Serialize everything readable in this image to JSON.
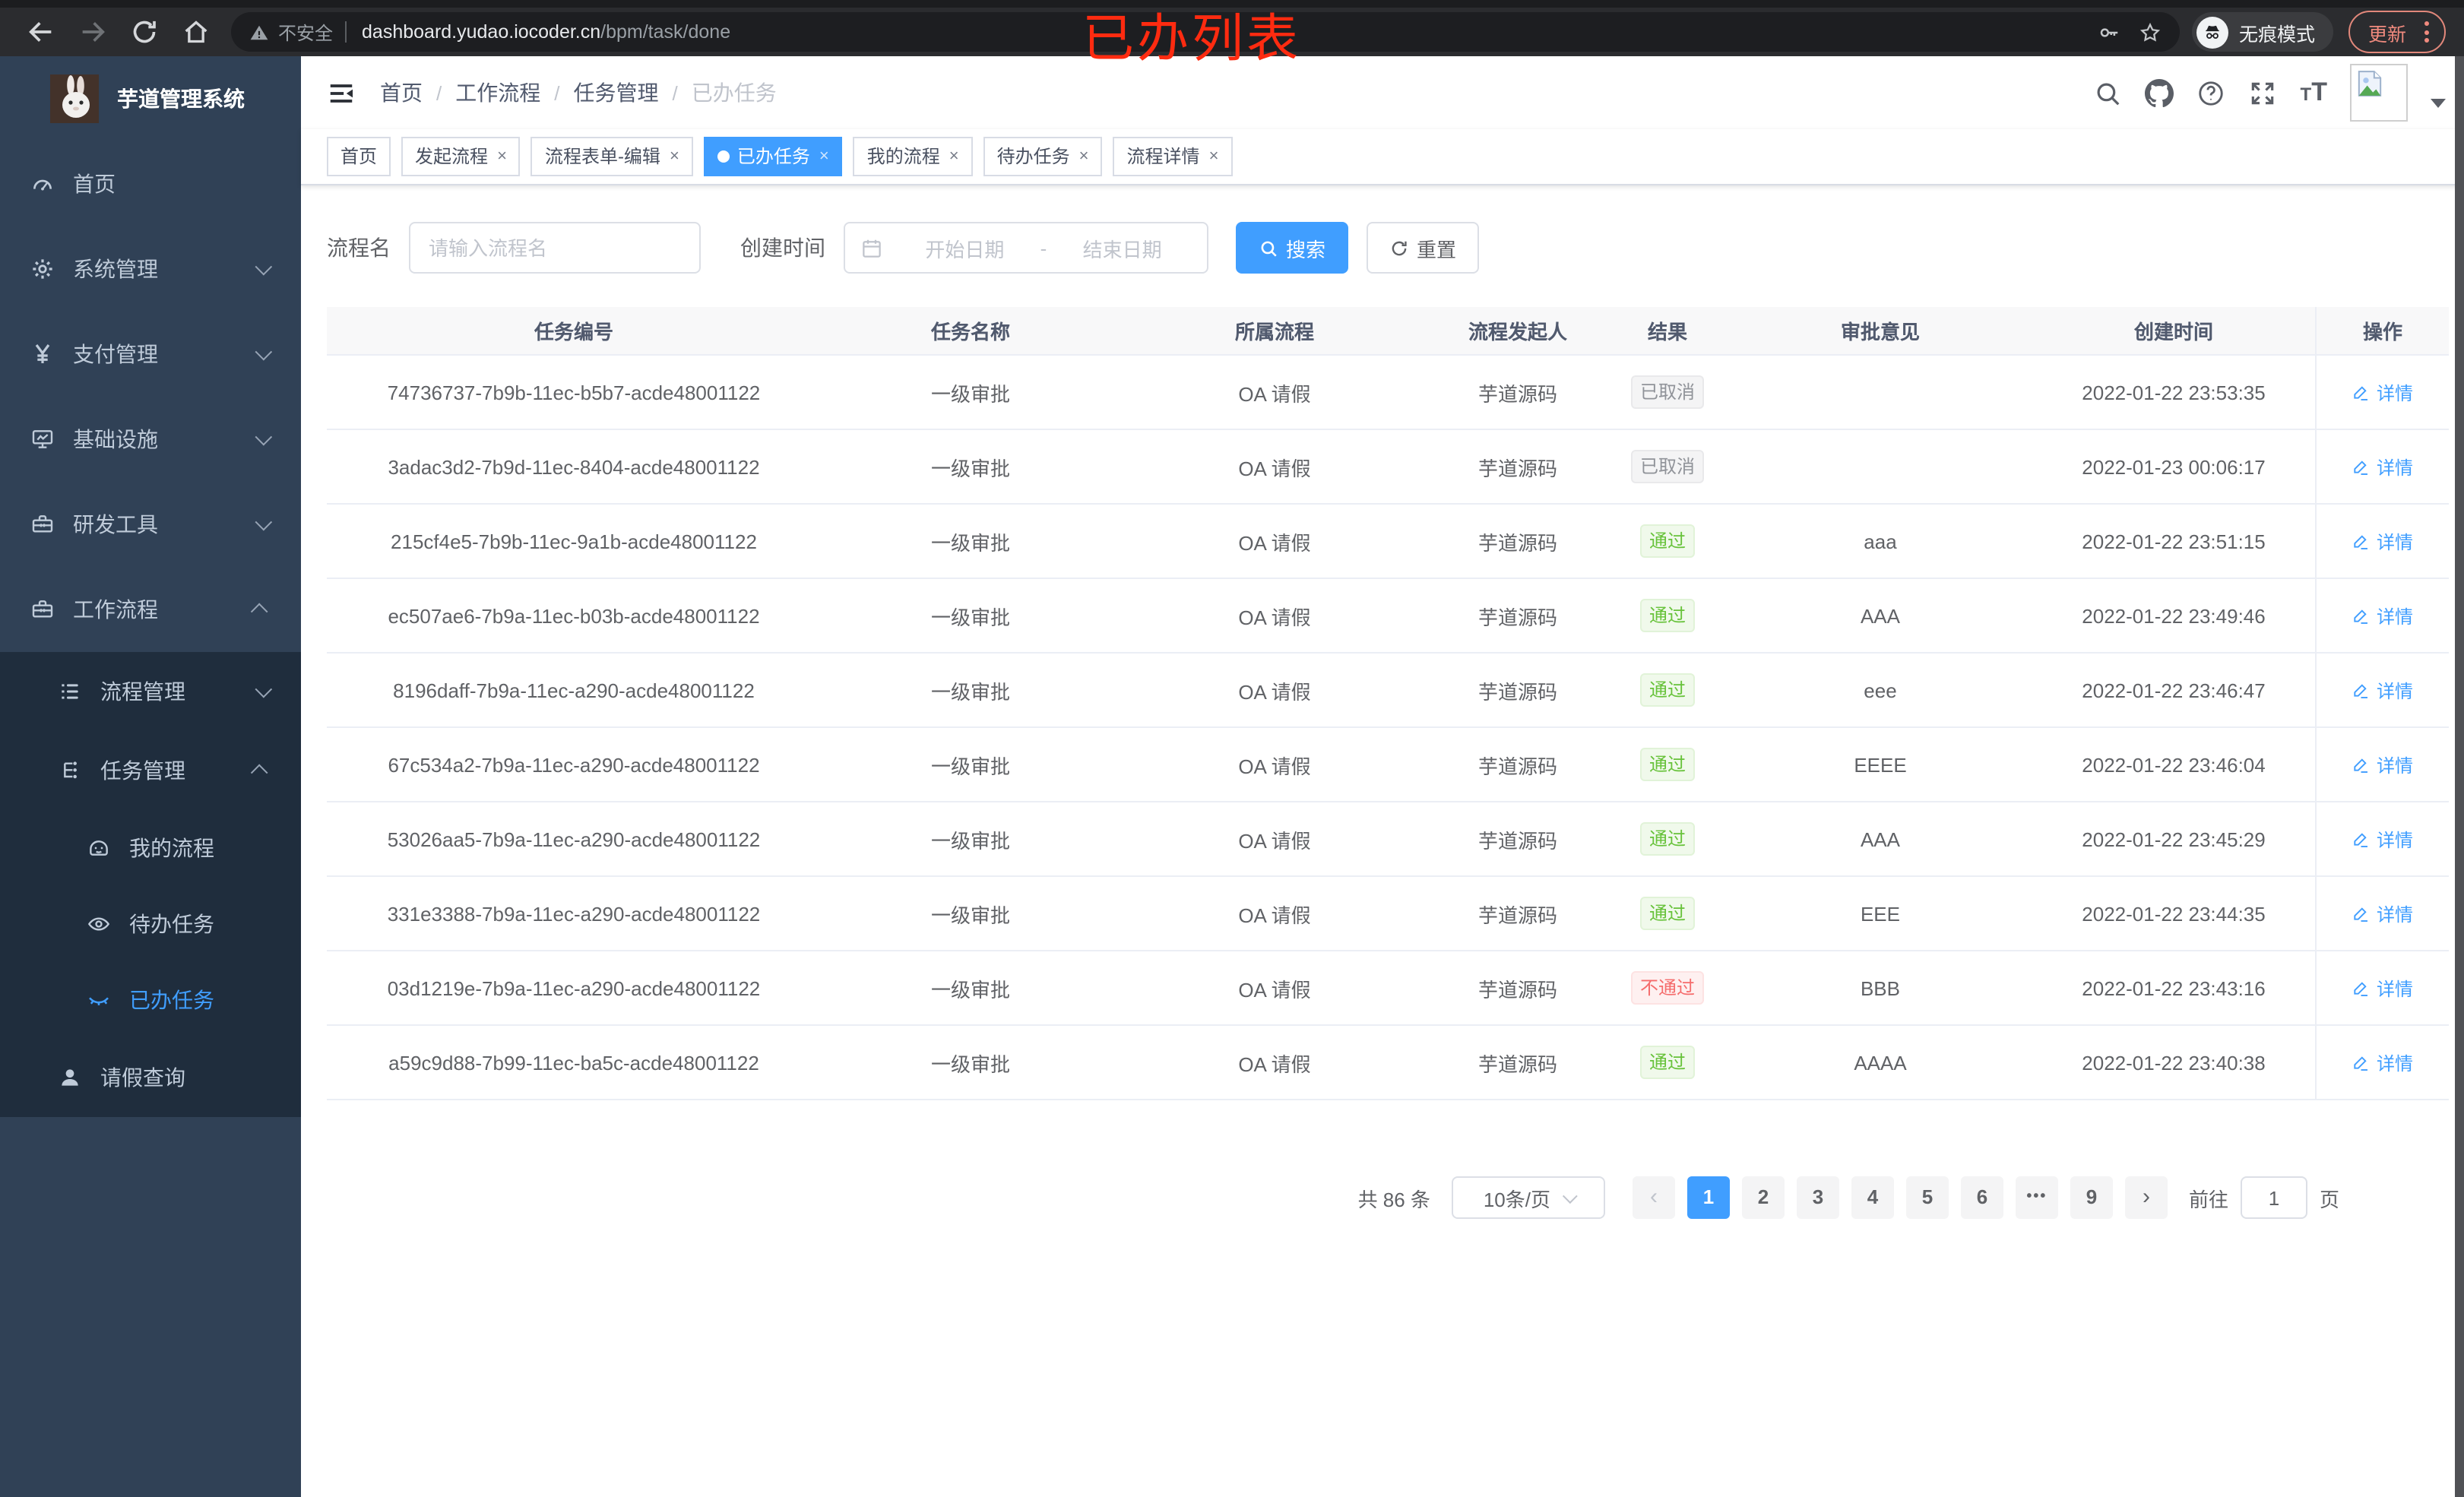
{
  "browser": {
    "security_label": "不安全",
    "url_host": "dashboard.yudao.iocoder.cn",
    "url_path": "/bpm/task/done",
    "incognito_label": "无痕模式",
    "update_label": "更新",
    "annotation": "已办列表"
  },
  "sidebar": {
    "title": "芋道管理系统",
    "items": [
      {
        "key": "home",
        "label": "首页",
        "icon": "gauge",
        "level": 1
      },
      {
        "key": "system-management",
        "label": "系统管理",
        "icon": "gear",
        "level": 1,
        "chevron": "down"
      },
      {
        "key": "payment-management",
        "label": "支付管理",
        "icon": "yen",
        "level": 1,
        "chevron": "down"
      },
      {
        "key": "infrastructure",
        "label": "基础设施",
        "icon": "monitor",
        "level": 1,
        "chevron": "down"
      },
      {
        "key": "dev-tools",
        "label": "研发工具",
        "icon": "toolbox",
        "level": 1,
        "chevron": "down"
      },
      {
        "key": "workflow",
        "label": "工作流程",
        "icon": "briefcase",
        "level": 1,
        "chevron": "up"
      },
      {
        "key": "process-management",
        "label": "流程管理",
        "icon": "list",
        "level": 2,
        "chevron": "down",
        "dark": true
      },
      {
        "key": "task-management",
        "label": "任务管理",
        "icon": "flow",
        "level": 2,
        "chevron": "up",
        "dark": true
      },
      {
        "key": "my-process",
        "label": "我的流程",
        "icon": "face",
        "level": 3,
        "dark": true
      },
      {
        "key": "todo-tasks",
        "label": "待办任务",
        "icon": "eye",
        "level": 3,
        "dark": true
      },
      {
        "key": "done-tasks",
        "label": "已办任务",
        "icon": "eye-closed",
        "level": 3,
        "dark": true,
        "active": true
      },
      {
        "key": "leave-query",
        "label": "请假查询",
        "icon": "user",
        "level": 2,
        "dark": true
      }
    ]
  },
  "breadcrumb": {
    "items": [
      "首页",
      "工作流程",
      "任务管理",
      "已办任务"
    ],
    "separator": "/"
  },
  "tags_view": {
    "items": [
      {
        "key": "home",
        "label": "首页",
        "closable": false,
        "active": false
      },
      {
        "key": "start-process",
        "label": "发起流程",
        "closable": true,
        "active": false
      },
      {
        "key": "process-form-edit",
        "label": "流程表单-编辑",
        "closable": true,
        "active": false
      },
      {
        "key": "done-tasks",
        "label": "已办任务",
        "closable": true,
        "active": true
      },
      {
        "key": "my-process",
        "label": "我的流程",
        "closable": true,
        "active": false
      },
      {
        "key": "todo-tasks",
        "label": "待办任务",
        "closable": true,
        "active": false
      },
      {
        "key": "process-detail",
        "label": "流程详情",
        "closable": true,
        "active": false
      }
    ],
    "close_glyph": "×"
  },
  "filters": {
    "name_label": "流程名",
    "name_placeholder": "请输入流程名",
    "time_label": "创建时间",
    "start_placeholder": "开始日期",
    "range_separator": "-",
    "end_placeholder": "结束日期",
    "search_label": "搜索",
    "reset_label": "重置"
  },
  "table": {
    "columns": [
      "任务编号",
      "任务名称",
      "所属流程",
      "流程发起人",
      "结果",
      "审批意见",
      "创建时间",
      "操作"
    ],
    "action_label": "详情",
    "rows": [
      {
        "id": "74736737-7b9b-11ec-b5b7-acde48001122",
        "name": "一级审批",
        "process": "OA 请假",
        "starter": "芋道源码",
        "result": "已取消",
        "result_type": "info",
        "comment": "",
        "time": "2022-01-22 23:53:35"
      },
      {
        "id": "3adac3d2-7b9d-11ec-8404-acde48001122",
        "name": "一级审批",
        "process": "OA 请假",
        "starter": "芋道源码",
        "result": "已取消",
        "result_type": "info",
        "comment": "",
        "time": "2022-01-23 00:06:17"
      },
      {
        "id": "215cf4e5-7b9b-11ec-9a1b-acde48001122",
        "name": "一级审批",
        "process": "OA 请假",
        "starter": "芋道源码",
        "result": "通过",
        "result_type": "success",
        "comment": "aaa",
        "time": "2022-01-22 23:51:15"
      },
      {
        "id": "ec507ae6-7b9a-11ec-b03b-acde48001122",
        "name": "一级审批",
        "process": "OA 请假",
        "starter": "芋道源码",
        "result": "通过",
        "result_type": "success",
        "comment": "AAA",
        "time": "2022-01-22 23:49:46"
      },
      {
        "id": "8196daff-7b9a-11ec-a290-acde48001122",
        "name": "一级审批",
        "process": "OA 请假",
        "starter": "芋道源码",
        "result": "通过",
        "result_type": "success",
        "comment": "eee",
        "time": "2022-01-22 23:46:47"
      },
      {
        "id": "67c534a2-7b9a-11ec-a290-acde48001122",
        "name": "一级审批",
        "process": "OA 请假",
        "starter": "芋道源码",
        "result": "通过",
        "result_type": "success",
        "comment": "EEEE",
        "time": "2022-01-22 23:46:04"
      },
      {
        "id": "53026aa5-7b9a-11ec-a290-acde48001122",
        "name": "一级审批",
        "process": "OA 请假",
        "starter": "芋道源码",
        "result": "通过",
        "result_type": "success",
        "comment": "AAA",
        "time": "2022-01-22 23:45:29"
      },
      {
        "id": "331e3388-7b9a-11ec-a290-acde48001122",
        "name": "一级审批",
        "process": "OA 请假",
        "starter": "芋道源码",
        "result": "通过",
        "result_type": "success",
        "comment": "EEE",
        "time": "2022-01-22 23:44:35"
      },
      {
        "id": "03d1219e-7b9a-11ec-a290-acde48001122",
        "name": "一级审批",
        "process": "OA 请假",
        "starter": "芋道源码",
        "result": "不通过",
        "result_type": "danger",
        "comment": "BBB",
        "time": "2022-01-22 23:43:16"
      },
      {
        "id": "a59c9d88-7b99-11ec-ba5c-acde48001122",
        "name": "一级审批",
        "process": "OA 请假",
        "starter": "芋道源码",
        "result": "通过",
        "result_type": "success",
        "comment": "AAAA",
        "time": "2022-01-22 23:40:38"
      }
    ]
  },
  "pagination": {
    "total_label": "共 86 条",
    "page_size": "10条/页",
    "pages": [
      "1",
      "2",
      "3",
      "4",
      "5",
      "6",
      "•••",
      "9"
    ],
    "active_page": "1",
    "goto_label": "前往",
    "goto_value": "1",
    "page_suffix": "页"
  },
  "colors": {
    "accent": "#409eff",
    "sidebar_bg": "#304156",
    "submenu_bg": "#1f2d3d",
    "success": "#67c23a",
    "danger": "#f56c6c",
    "info": "#909399"
  }
}
